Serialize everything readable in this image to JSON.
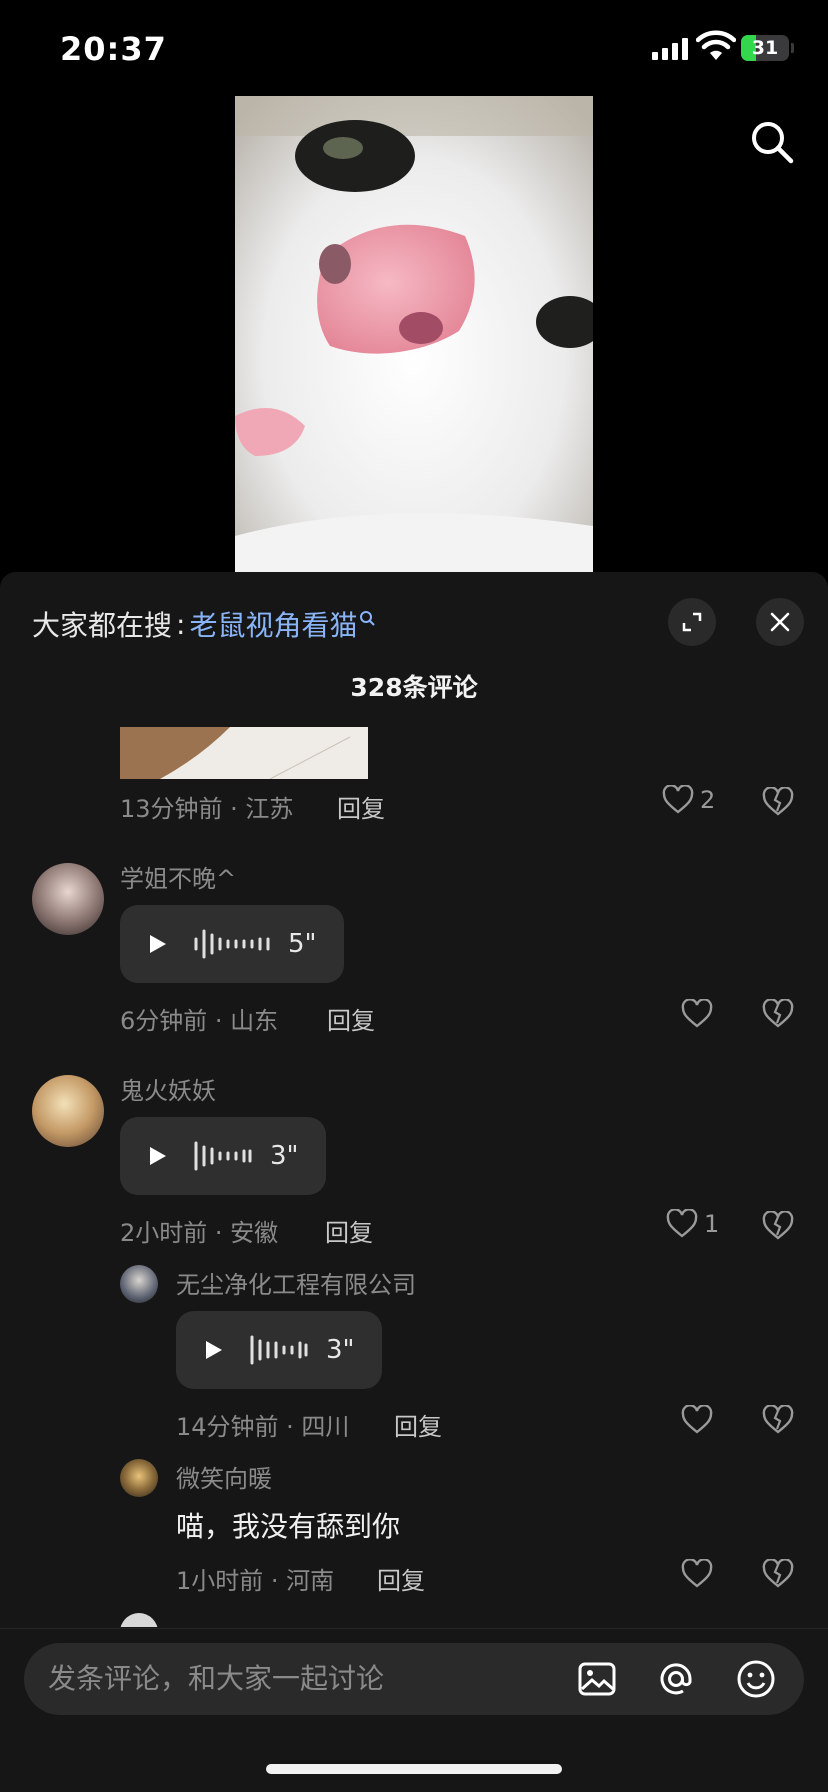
{
  "status_bar": {
    "time": "20:37",
    "battery_level": "31",
    "battery_fraction": 0.31
  },
  "video": {
    "search_icon": "search-icon"
  },
  "trending": {
    "prefix": "大家都在搜",
    "separator": ":",
    "term": "老鼠视角看猫"
  },
  "comments_header": {
    "count_text": "328条评论"
  },
  "comments": [
    {
      "time_location": "13分钟前 · 江苏",
      "reply": "回复",
      "likes": "2"
    },
    {
      "username": "学姐不晚^",
      "voice_duration": "5\"",
      "time_location": "6分钟前 · 山东",
      "reply": "回复"
    },
    {
      "username": "鬼火妖妖",
      "voice_duration": "3\"",
      "time_location": "2小时前 · 安徽",
      "reply": "回复",
      "likes": "1"
    },
    {
      "username": "无尘净化工程有限公司",
      "voice_duration": "3\"",
      "time_location": "14分钟前 · 四川",
      "reply": "回复"
    },
    {
      "username": "微笑向暖",
      "text": "喵，我没有舔到你",
      "time_location": "1小时前 · 河南",
      "reply": "回复"
    }
  ],
  "input": {
    "placeholder": "发条评论，和大家一起讨论"
  },
  "icons": [
    "search-icon",
    "expand-icon",
    "close-icon",
    "heart-icon",
    "broken-heart-icon",
    "play-icon",
    "waveform-icon",
    "image-icon",
    "at-icon",
    "emoji-icon"
  ],
  "colors": {
    "accent_link": "#8ab4f8",
    "sheet_bg": "#161616",
    "battery_green": "#32d74b"
  }
}
